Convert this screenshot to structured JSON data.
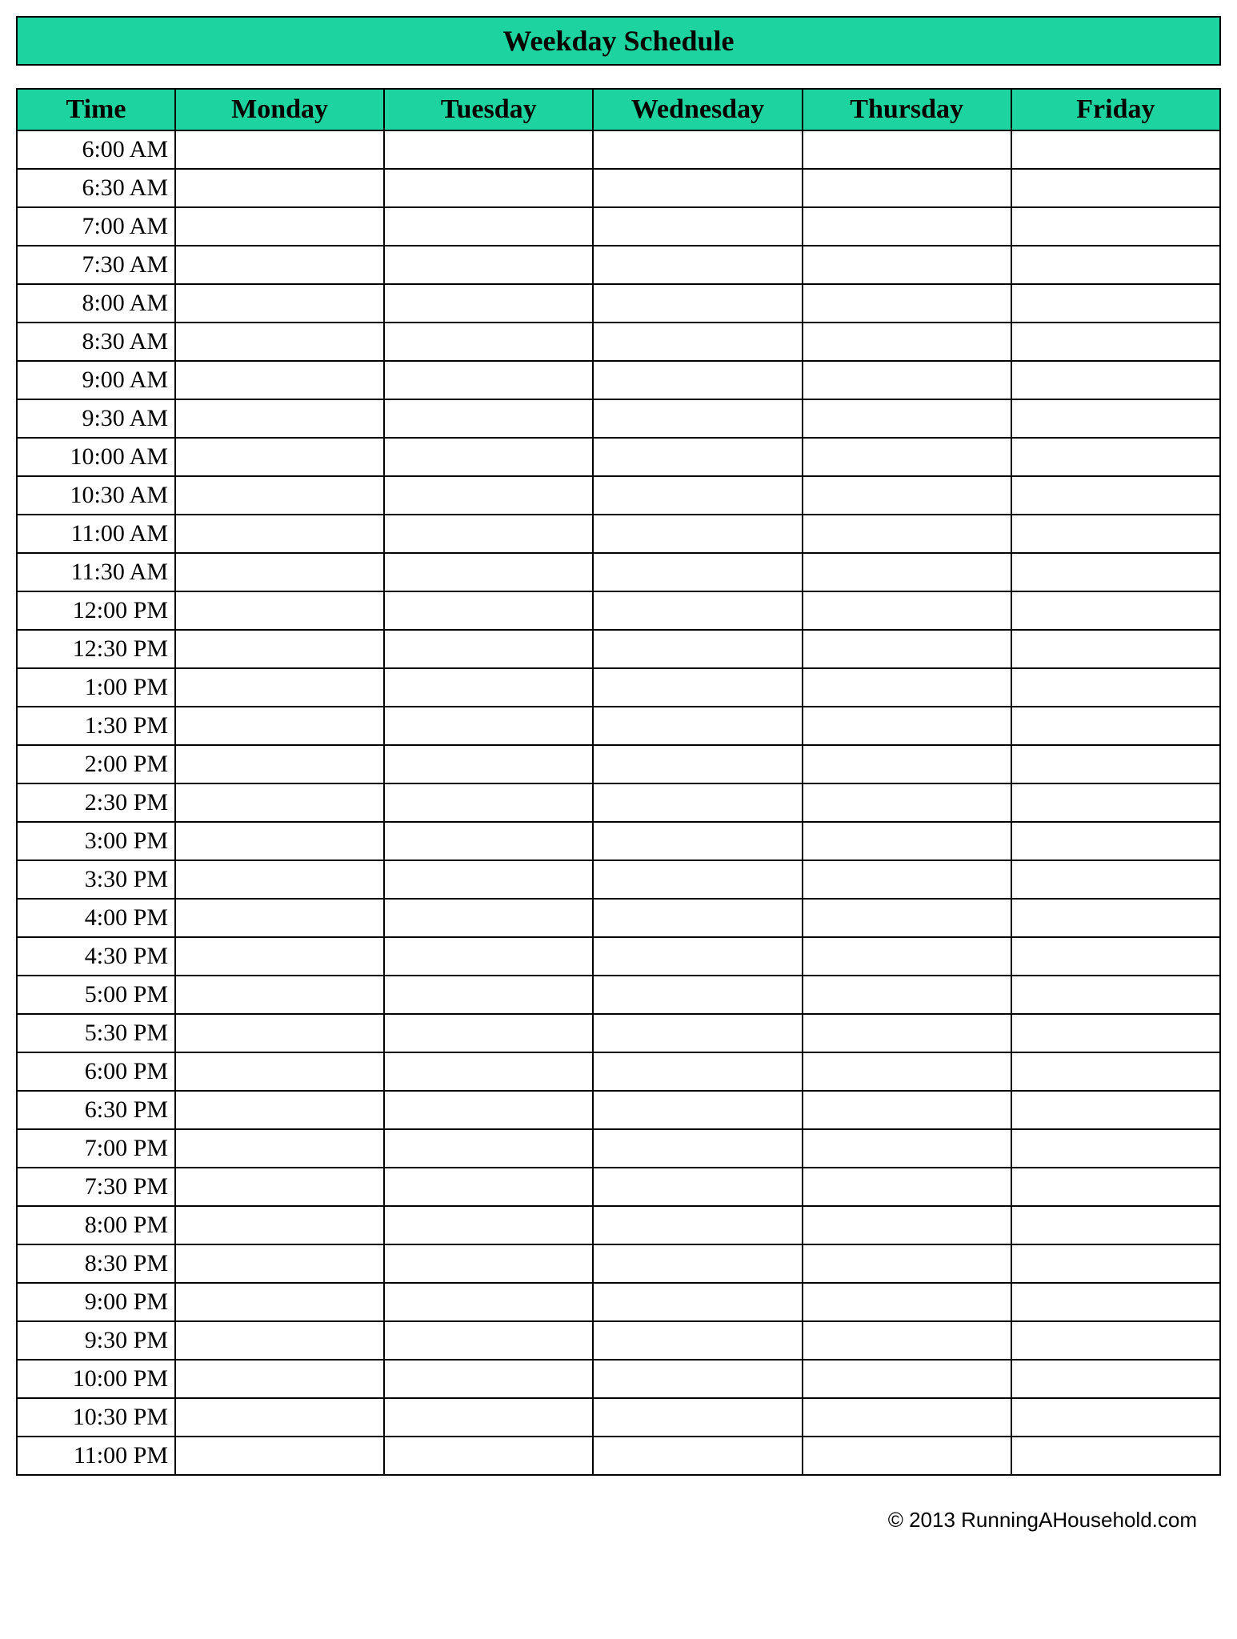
{
  "title": "Weekday Schedule",
  "headers": {
    "time": "Time",
    "days": [
      "Monday",
      "Tuesday",
      "Wednesday",
      "Thursday",
      "Friday"
    ]
  },
  "times": [
    "6:00 AM",
    "6:30 AM",
    "7:00 AM",
    "7:30 AM",
    "8:00 AM",
    "8:30 AM",
    "9:00 AM",
    "9:30 AM",
    "10:00 AM",
    "10:30 AM",
    "11:00 AM",
    "11:30 AM",
    "12:00 PM",
    "12:30 PM",
    "1:00 PM",
    "1:30 PM",
    "2:00 PM",
    "2:30 PM",
    "3:00 PM",
    "3:30 PM",
    "4:00 PM",
    "4:30 PM",
    "5:00 PM",
    "5:30 PM",
    "6:00 PM",
    "6:30 PM",
    "7:00 PM",
    "7:30 PM",
    "8:00 PM",
    "8:30 PM",
    "9:00 PM",
    "9:30 PM",
    "10:00 PM",
    "10:30 PM",
    "11:00 PM"
  ],
  "footer": "© 2013 RunningAHousehold.com",
  "colors": {
    "accent": "#1dd39f"
  }
}
